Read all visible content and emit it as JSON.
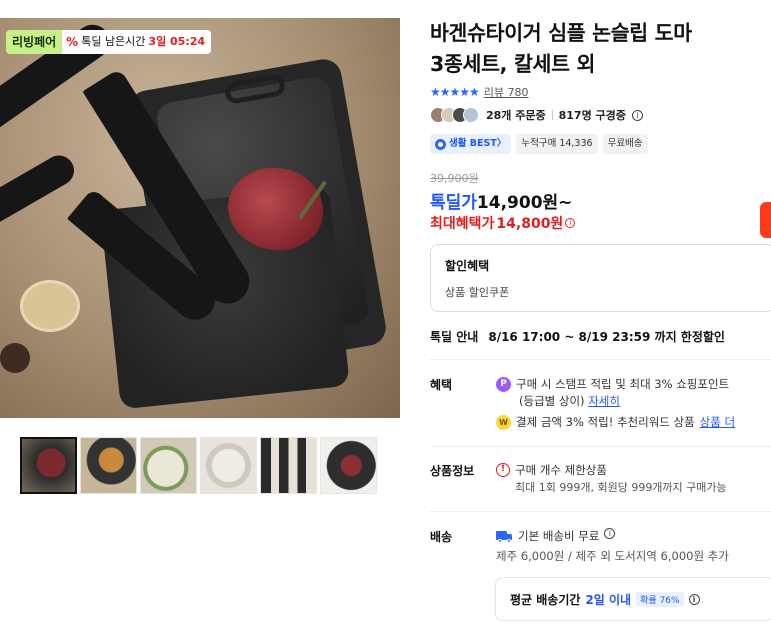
{
  "image_badge": {
    "brand": "리빙페어",
    "timer_label": "톡딜 남은시간",
    "timer_value": "3일 05:24"
  },
  "product": {
    "title_line1": "바겐슈타이거 심플 논슬립 도마",
    "title_line2": "3종세트, 칼세트 외",
    "rating_stars": "★★★★★",
    "review_link": "리뷰 780",
    "stats": {
      "orders": "28개 주문중",
      "subscribers": "817명 구경중"
    },
    "tags": [
      "생활 BEST〉",
      "누적구매 14,336",
      "무료배송"
    ]
  },
  "pricing": {
    "original": "39,900원",
    "deal_label": "톡딜가",
    "deal_amount": "14,900원~",
    "max_benefit_label": "최대혜택가",
    "max_benefit_amount": "14,800원"
  },
  "discount_box": {
    "title": "할인혜택",
    "detail": "상품 할인쿠폰"
  },
  "deal_period": {
    "label": "톡딜 안내",
    "text": "8/16 17:00 ~ 8/19 23:59 까지 한정할인"
  },
  "benefits": {
    "label": "혜택",
    "line1": "구매 시 스탬프 적립 및 최대 3% 쇼핑포인트",
    "line1_sub": "(등급별 상이)",
    "line1_link": "자세히",
    "line2": "결제 금액 3% 적립! 추천리워드 상품",
    "line2_link": "상품 더"
  },
  "product_info": {
    "label": "상품정보",
    "line1": "구매 개수 제한상품",
    "line2": "최대 1회 999개, 회원당 999개까지 구매가능"
  },
  "shipping": {
    "label": "배송",
    "line1": "기본 배송비 무료",
    "line2": "제주 6,000원 / 제주 외 도서지역 6,000원 추가",
    "avg_label": "평균 배송기간",
    "avg_value": "2일 이내",
    "probability": "확률 76%"
  },
  "colors": {
    "accent_blue": "#1f56ff",
    "price_red": "#e02020",
    "badge_green": "#c8f08a"
  }
}
